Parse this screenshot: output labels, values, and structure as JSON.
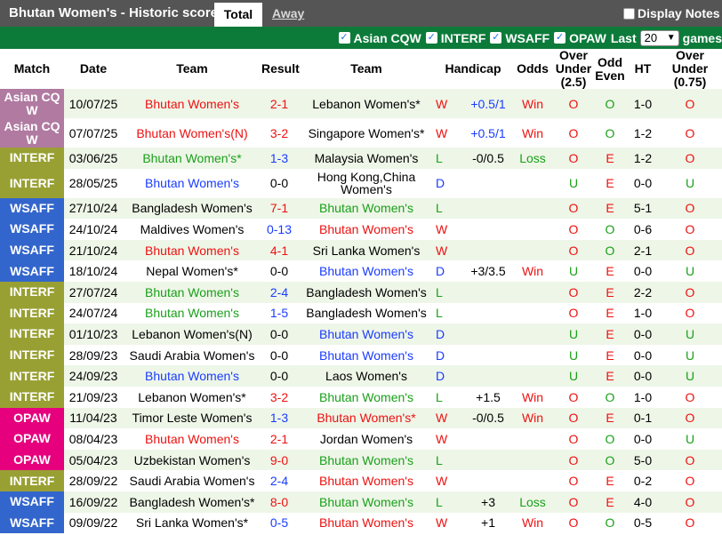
{
  "header": {
    "title": "Bhutan Women's - Historic scores",
    "tab_total": "Total",
    "tab_away": "Away",
    "display_notes": "Display Notes"
  },
  "filters": {
    "items": [
      {
        "label": "Asian CQW",
        "checked": true
      },
      {
        "label": "INTERF",
        "checked": true
      },
      {
        "label": "WSAFF",
        "checked": true
      },
      {
        "label": "OPAW",
        "checked": true
      }
    ],
    "last_label": "Last",
    "games_count": "20",
    "games_label": "games"
  },
  "columns": [
    "Match",
    "Date",
    "Team",
    "Result",
    "Team",
    "Handicap",
    "Odds",
    "Over Under (2.5)",
    "Odd Even",
    "HT",
    "Over Under (0.75)"
  ],
  "colors": {
    "Asian CQW": "#b07aa1",
    "INTERF": "#99a033",
    "WSAFF": "#3366cc",
    "OPAW": "#e6007e",
    "red": "#ee1111",
    "blue": "#1a3cff",
    "green": "#1aa01a"
  },
  "rows": [
    {
      "match": "Asian CQ W",
      "date": "10/07/25",
      "home": "Bhutan Women's",
      "home_color": "red",
      "result": "2-1",
      "result_color": "red",
      "away": "Lebanon Women's*",
      "away_color": "black",
      "wl": "W",
      "wl_color": "red",
      "handicap": "+0.5/1",
      "hcp_color": "blue",
      "odds": "Win",
      "odds_color": "red",
      "ou": "O",
      "ou_color": "red",
      "oe": "O",
      "oe_color": "green",
      "ht": "1-0",
      "ou2": "O",
      "ou2_color": "red"
    },
    {
      "match": "Asian CQ W",
      "date": "07/07/25",
      "home": "Bhutan Women's(N)",
      "home_color": "red",
      "result": "3-2",
      "result_color": "red",
      "away": "Singapore Women's*",
      "away_color": "black",
      "wl": "W",
      "wl_color": "red",
      "handicap": "+0.5/1",
      "hcp_color": "blue",
      "odds": "Win",
      "odds_color": "red",
      "ou": "O",
      "ou_color": "red",
      "oe": "O",
      "oe_color": "green",
      "ht": "1-2",
      "ou2": "O",
      "ou2_color": "red"
    },
    {
      "match": "INTERF",
      "date": "03/06/25",
      "home": "Bhutan Women's*",
      "home_color": "green",
      "result": "1-3",
      "result_color": "blue",
      "away": "Malaysia Women's",
      "away_color": "black",
      "wl": "L",
      "wl_color": "green",
      "handicap": "-0/0.5",
      "hcp_color": "black",
      "odds": "Loss",
      "odds_color": "green",
      "ou": "O",
      "ou_color": "red",
      "oe": "E",
      "oe_color": "red",
      "ht": "1-2",
      "ou2": "O",
      "ou2_color": "red"
    },
    {
      "match": "INTERF",
      "date": "28/05/25",
      "home": "Bhutan Women's",
      "home_color": "blue",
      "result": "0-0",
      "result_color": "black",
      "away": "Hong Kong,China Women's",
      "away_color": "black",
      "wl": "D",
      "wl_color": "blue",
      "handicap": "",
      "hcp_color": "black",
      "odds": "",
      "odds_color": "black",
      "ou": "U",
      "ou_color": "green",
      "oe": "E",
      "oe_color": "red",
      "ht": "0-0",
      "ou2": "U",
      "ou2_color": "green"
    },
    {
      "match": "WSAFF",
      "date": "27/10/24",
      "home": "Bangladesh Women's",
      "home_color": "black",
      "result": "7-1",
      "result_color": "red",
      "away": "Bhutan Women's",
      "away_color": "green",
      "wl": "L",
      "wl_color": "green",
      "handicap": "",
      "hcp_color": "black",
      "odds": "",
      "odds_color": "black",
      "ou": "O",
      "ou_color": "red",
      "oe": "E",
      "oe_color": "red",
      "ht": "5-1",
      "ou2": "O",
      "ou2_color": "red"
    },
    {
      "match": "WSAFF",
      "date": "24/10/24",
      "home": "Maldives Women's",
      "home_color": "black",
      "result": "0-13",
      "result_color": "blue",
      "away": "Bhutan Women's",
      "away_color": "red",
      "wl": "W",
      "wl_color": "red",
      "handicap": "",
      "hcp_color": "black",
      "odds": "",
      "odds_color": "black",
      "ou": "O",
      "ou_color": "red",
      "oe": "O",
      "oe_color": "green",
      "ht": "0-6",
      "ou2": "O",
      "ou2_color": "red"
    },
    {
      "match": "WSAFF",
      "date": "21/10/24",
      "home": "Bhutan Women's",
      "home_color": "red",
      "result": "4-1",
      "result_color": "red",
      "away": "Sri Lanka Women's",
      "away_color": "black",
      "wl": "W",
      "wl_color": "red",
      "handicap": "",
      "hcp_color": "black",
      "odds": "",
      "odds_color": "black",
      "ou": "O",
      "ou_color": "red",
      "oe": "O",
      "oe_color": "green",
      "ht": "2-1",
      "ou2": "O",
      "ou2_color": "red"
    },
    {
      "match": "WSAFF",
      "date": "18/10/24",
      "home": "Nepal Women's*",
      "home_color": "black",
      "result": "0-0",
      "result_color": "black",
      "away": "Bhutan Women's",
      "away_color": "blue",
      "wl": "D",
      "wl_color": "blue",
      "handicap": "+3/3.5",
      "hcp_color": "black",
      "odds": "Win",
      "odds_color": "red",
      "ou": "U",
      "ou_color": "green",
      "oe": "E",
      "oe_color": "red",
      "ht": "0-0",
      "ou2": "U",
      "ou2_color": "green"
    },
    {
      "match": "INTERF",
      "date": "27/07/24",
      "home": "Bhutan Women's",
      "home_color": "green",
      "result": "2-4",
      "result_color": "blue",
      "away": "Bangladesh Women's",
      "away_color": "black",
      "wl": "L",
      "wl_color": "green",
      "handicap": "",
      "hcp_color": "black",
      "odds": "",
      "odds_color": "black",
      "ou": "O",
      "ou_color": "red",
      "oe": "E",
      "oe_color": "red",
      "ht": "2-2",
      "ou2": "O",
      "ou2_color": "red"
    },
    {
      "match": "INTERF",
      "date": "24/07/24",
      "home": "Bhutan Women's",
      "home_color": "green",
      "result": "1-5",
      "result_color": "blue",
      "away": "Bangladesh Women's",
      "away_color": "black",
      "wl": "L",
      "wl_color": "green",
      "handicap": "",
      "hcp_color": "black",
      "odds": "",
      "odds_color": "black",
      "ou": "O",
      "ou_color": "red",
      "oe": "E",
      "oe_color": "red",
      "ht": "1-0",
      "ou2": "O",
      "ou2_color": "red"
    },
    {
      "match": "INTERF",
      "date": "01/10/23",
      "home": "Lebanon Women's(N)",
      "home_color": "black",
      "result": "0-0",
      "result_color": "black",
      "away": "Bhutan Women's",
      "away_color": "blue",
      "wl": "D",
      "wl_color": "blue",
      "handicap": "",
      "hcp_color": "black",
      "odds": "",
      "odds_color": "black",
      "ou": "U",
      "ou_color": "green",
      "oe": "E",
      "oe_color": "red",
      "ht": "0-0",
      "ou2": "U",
      "ou2_color": "green"
    },
    {
      "match": "INTERF",
      "date": "28/09/23",
      "home": "Saudi Arabia Women's",
      "home_color": "black",
      "result": "0-0",
      "result_color": "black",
      "away": "Bhutan Women's",
      "away_color": "blue",
      "wl": "D",
      "wl_color": "blue",
      "handicap": "",
      "hcp_color": "black",
      "odds": "",
      "odds_color": "black",
      "ou": "U",
      "ou_color": "green",
      "oe": "E",
      "oe_color": "red",
      "ht": "0-0",
      "ou2": "U",
      "ou2_color": "green"
    },
    {
      "match": "INTERF",
      "date": "24/09/23",
      "home": "Bhutan Women's",
      "home_color": "blue",
      "result": "0-0",
      "result_color": "black",
      "away": "Laos Women's",
      "away_color": "black",
      "wl": "D",
      "wl_color": "blue",
      "handicap": "",
      "hcp_color": "black",
      "odds": "",
      "odds_color": "black",
      "ou": "U",
      "ou_color": "green",
      "oe": "E",
      "oe_color": "red",
      "ht": "0-0",
      "ou2": "U",
      "ou2_color": "green"
    },
    {
      "match": "INTERF",
      "date": "21/09/23",
      "home": "Lebanon Women's*",
      "home_color": "black",
      "result": "3-2",
      "result_color": "red",
      "away": "Bhutan Women's",
      "away_color": "green",
      "wl": "L",
      "wl_color": "green",
      "handicap": "+1.5",
      "hcp_color": "black",
      "odds": "Win",
      "odds_color": "red",
      "ou": "O",
      "ou_color": "red",
      "oe": "O",
      "oe_color": "green",
      "ht": "1-0",
      "ou2": "O",
      "ou2_color": "red"
    },
    {
      "match": "OPAW",
      "date": "11/04/23",
      "home": "Timor Leste Women's",
      "home_color": "black",
      "result": "1-3",
      "result_color": "blue",
      "away": "Bhutan Women's*",
      "away_color": "red",
      "wl": "W",
      "wl_color": "red",
      "handicap": "-0/0.5",
      "hcp_color": "black",
      "odds": "Win",
      "odds_color": "red",
      "ou": "O",
      "ou_color": "red",
      "oe": "E",
      "oe_color": "red",
      "ht": "0-1",
      "ou2": "O",
      "ou2_color": "red"
    },
    {
      "match": "OPAW",
      "date": "08/04/23",
      "home": "Bhutan Women's",
      "home_color": "red",
      "result": "2-1",
      "result_color": "red",
      "away": "Jordan Women's",
      "away_color": "black",
      "wl": "W",
      "wl_color": "red",
      "handicap": "",
      "hcp_color": "black",
      "odds": "",
      "odds_color": "black",
      "ou": "O",
      "ou_color": "red",
      "oe": "O",
      "oe_color": "green",
      "ht": "0-0",
      "ou2": "U",
      "ou2_color": "green"
    },
    {
      "match": "OPAW",
      "date": "05/04/23",
      "home": "Uzbekistan Women's",
      "home_color": "black",
      "result": "9-0",
      "result_color": "red",
      "away": "Bhutan Women's",
      "away_color": "green",
      "wl": "L",
      "wl_color": "green",
      "handicap": "",
      "hcp_color": "black",
      "odds": "",
      "odds_color": "black",
      "ou": "O",
      "ou_color": "red",
      "oe": "O",
      "oe_color": "green",
      "ht": "5-0",
      "ou2": "O",
      "ou2_color": "red"
    },
    {
      "match": "INTERF",
      "date": "28/09/22",
      "home": "Saudi Arabia Women's",
      "home_color": "black",
      "result": "2-4",
      "result_color": "blue",
      "away": "Bhutan Women's",
      "away_color": "red",
      "wl": "W",
      "wl_color": "red",
      "handicap": "",
      "hcp_color": "black",
      "odds": "",
      "odds_color": "black",
      "ou": "O",
      "ou_color": "red",
      "oe": "E",
      "oe_color": "red",
      "ht": "0-2",
      "ou2": "O",
      "ou2_color": "red"
    },
    {
      "match": "WSAFF",
      "date": "16/09/22",
      "home": "Bangladesh Women's*",
      "home_color": "black",
      "result": "8-0",
      "result_color": "red",
      "away": "Bhutan Women's",
      "away_color": "green",
      "wl": "L",
      "wl_color": "green",
      "handicap": "+3",
      "hcp_color": "black",
      "odds": "Loss",
      "odds_color": "green",
      "ou": "O",
      "ou_color": "red",
      "oe": "E",
      "oe_color": "red",
      "ht": "4-0",
      "ou2": "O",
      "ou2_color": "red"
    },
    {
      "match": "WSAFF",
      "date": "09/09/22",
      "home": "Sri Lanka Women's*",
      "home_color": "black",
      "result": "0-5",
      "result_color": "blue",
      "away": "Bhutan Women's",
      "away_color": "red",
      "wl": "W",
      "wl_color": "red",
      "handicap": "+1",
      "hcp_color": "black",
      "odds": "Win",
      "odds_color": "red",
      "ou": "O",
      "ou_color": "red",
      "oe": "O",
      "oe_color": "green",
      "ht": "0-5",
      "ou2": "O",
      "ou2_color": "red"
    }
  ]
}
